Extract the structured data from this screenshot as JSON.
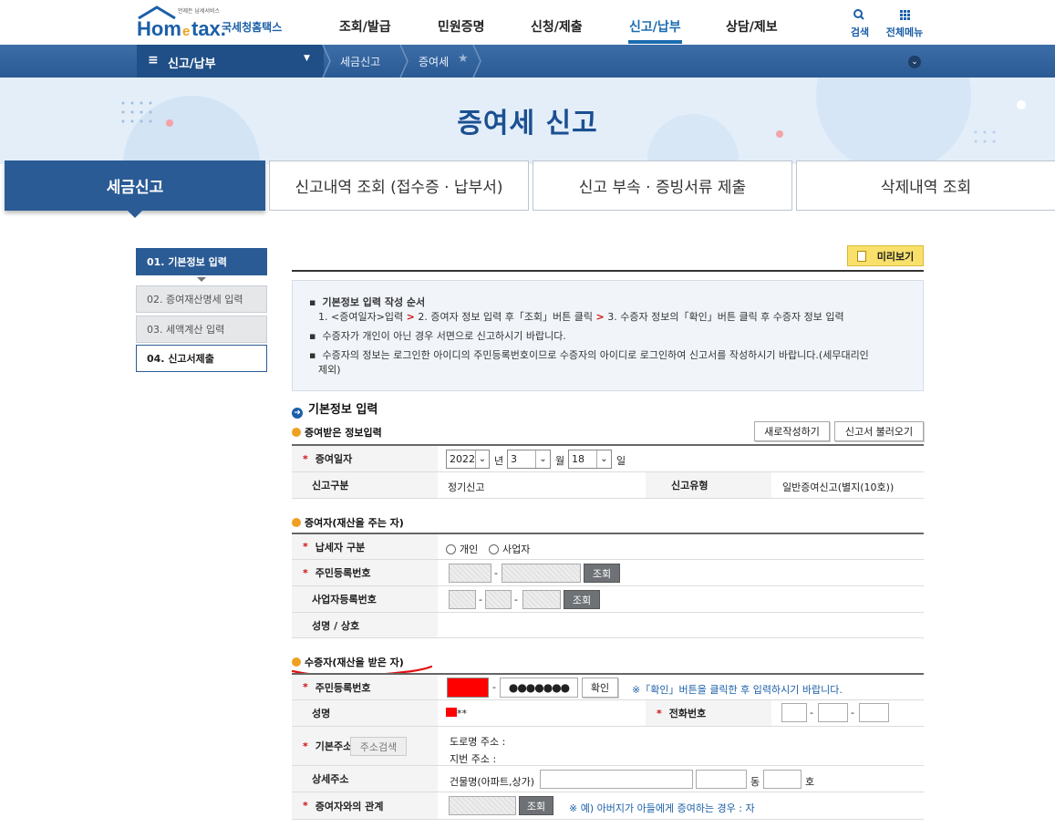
{
  "header": {
    "logo_text": "Hometax",
    "logo_sub": "국세청홈택스",
    "logo_tagline": "언제든 납세서비스",
    "menu": [
      "조회/발급",
      "민원증명",
      "신청/제출",
      "신고/납부",
      "상담/제보"
    ],
    "active_menu": "신고/납부",
    "search_label": "검색",
    "all_menu_label": "전체메뉴"
  },
  "nav": {
    "menu_label": "신고/납부",
    "breadcrumb": [
      "세금신고",
      "증여세"
    ]
  },
  "banner": {
    "title": "증여세 신고"
  },
  "tabs": [
    "세금신고",
    "신고내역 조회 (접수증 · 납부서)",
    "신고 부속 · 증빙서류 제출",
    "삭제내역 조회"
  ],
  "steps": [
    "01. 기본정보 입력",
    "02. 증여재산명세 입력",
    "03. 세액계산 입력",
    "04. 신고서제출"
  ],
  "preview_label": "미리보기",
  "guide": {
    "title": "기본정보 입력 작성 순서",
    "order_parts": [
      "1. <증여일자>입력",
      ">",
      "2. 증여자 정보 입력 후「조회」버튼 클릭",
      ">",
      "3. 수증자 정보의「확인」버튼 클릭 후 수증자 정보 입력"
    ],
    "items": [
      "수증자가 개인이 아닌 경우 서면으로 신고하시기 바랍니다.",
      "수증자의 정보는 로그인한 아이디의 주민등록번호이므로 수증자의 아이디로 로그인하여 신고서를 작성하시기 바랍니다.(세무대리인",
      "제외)"
    ]
  },
  "section_title": "기본정보 입력",
  "received": {
    "title": "증여받은 정보입력",
    "new_btn": "새로작성하기",
    "load_btn": "신고서 불러오기",
    "date_label": "증여일자",
    "year": "2022",
    "year_unit": "년",
    "month": "3",
    "month_unit": "월",
    "day": "18",
    "day_unit": "일",
    "type_label": "신고구분",
    "type_value": "정기신고",
    "form_label": "신고유형",
    "form_value": "일반증여신고(별지(10호))"
  },
  "donor": {
    "title": "증여자(재산을 주는 자)",
    "taxpayer_label": "납세자 구분",
    "opt_individual": "개인",
    "opt_business": "사업자",
    "rrn_label": "주민등록번호",
    "query_btn": "조회",
    "brn_label": "사업자등록번호",
    "name_label": "성명 / 상호",
    "dash": "-"
  },
  "recipient": {
    "title": "수증자(재산을 받은 자)",
    "rrn_label": "주민등록번호",
    "rrn_masked": "●●●●●●●",
    "confirm_btn": "확인",
    "confirm_note": "※「확인」버튼을 클릭한 후 입력하시기 바랍니다.",
    "name_label": "성명",
    "name_suffix": "**",
    "phone_label": "전화번호",
    "addr_label": "기본주소",
    "addr_search_btn": "주소검색",
    "road_addr": "도로명 주소 :",
    "lot_addr": "지번 주소 :",
    "detail_label": "상세주소",
    "building_label": "건물명(아파트,상가)",
    "dong": "동",
    "ho": "호",
    "relation_label": "증여자와의 관계",
    "relation_btn": "조회",
    "relation_note": "※ 예) 아버지가 아들에게 증여하는 경우 : 자"
  },
  "colors": {
    "brand": "#1b5fa8",
    "nav": "#2a5b95",
    "required": "#d01010",
    "redaction": "#ff0000"
  }
}
